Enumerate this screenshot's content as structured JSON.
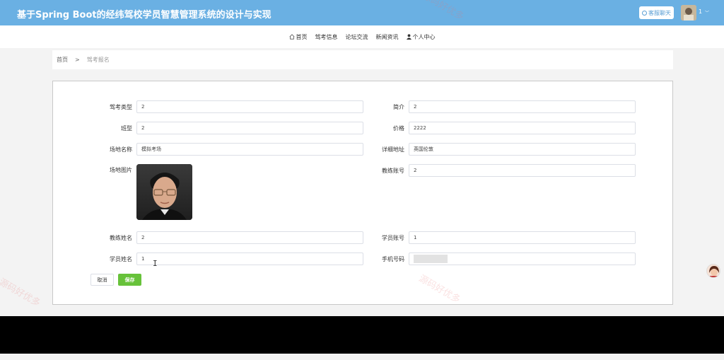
{
  "header": {
    "title": "基于Spring Boot的经纬驾校学员智慧管理系统的设计与实现",
    "chat_button": "客服聊天",
    "username": "1"
  },
  "nav": {
    "items": [
      {
        "label": "首页",
        "icon": "home-icon"
      },
      {
        "label": "驾考信息"
      },
      {
        "label": "论坛交流"
      },
      {
        "label": "新闻资讯"
      },
      {
        "label": "个人中心",
        "icon": "user-icon"
      }
    ]
  },
  "breadcrumb": {
    "home": "首页",
    "separator": ">",
    "current": "驾考报名"
  },
  "form": {
    "exam_type": {
      "label": "驾考类型",
      "value": "2"
    },
    "intro": {
      "label": "简介",
      "value": "2"
    },
    "class_type": {
      "label": "班型",
      "value": "2"
    },
    "price": {
      "label": "价格",
      "value": "2222"
    },
    "venue_name": {
      "label": "场地名称",
      "value": "模拟考场"
    },
    "address": {
      "label": "详细地址",
      "value": "英国伦敦"
    },
    "venue_image": {
      "label": "场地图片"
    },
    "coach_account": {
      "label": "教练账号",
      "value": "2"
    },
    "coach_name": {
      "label": "教练姓名",
      "value": "2"
    },
    "student_account": {
      "label": "学员账号",
      "value": "1"
    },
    "student_name": {
      "label": "学员姓名",
      "value": "1"
    },
    "phone": {
      "label": "手机号码",
      "value": ""
    }
  },
  "buttons": {
    "cancel": "取消",
    "save": "保存"
  },
  "watermark": "源码好优多",
  "colors": {
    "header_bg": "#6ab0e3",
    "save_button": "#67c23a",
    "footer_bg": "#000000"
  }
}
